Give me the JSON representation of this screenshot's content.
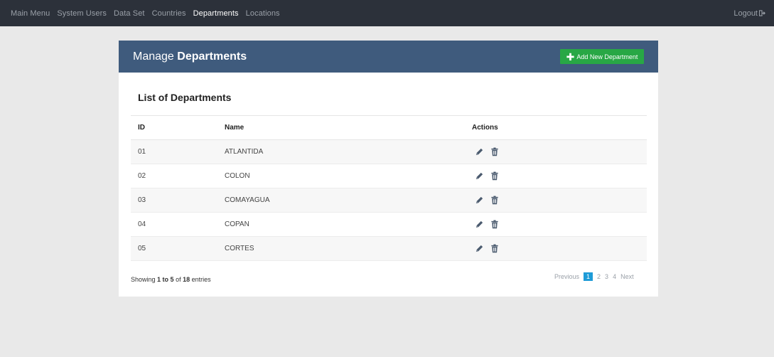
{
  "nav": {
    "items": [
      {
        "label": "Main Menu"
      },
      {
        "label": "System Users"
      },
      {
        "label": "Data Set"
      },
      {
        "label": "Countries"
      },
      {
        "label": "Departments"
      },
      {
        "label": "Locations"
      }
    ],
    "active": "Departments",
    "logout_label": "Logout"
  },
  "panel": {
    "title_prefix": "Manage",
    "title_main": "Departments",
    "add_button_label": "Add New Department",
    "list_title": "List of Departments"
  },
  "table": {
    "headers": [
      "ID",
      "Name",
      "Actions"
    ],
    "rows": [
      {
        "id": "01",
        "name": "ATLANTIDA"
      },
      {
        "id": "02",
        "name": "COLON"
      },
      {
        "id": "03",
        "name": "COMAYAGUA"
      },
      {
        "id": "04",
        "name": "COPAN"
      },
      {
        "id": "05",
        "name": "CORTES"
      }
    ]
  },
  "footer": {
    "showing_prefix": "Showing",
    "range": "1 to 5",
    "of_word": "of",
    "total": "18",
    "suffix": "entries"
  },
  "pagination": {
    "previous": "Previous",
    "pages": [
      "1",
      "2",
      "3",
      "4"
    ],
    "current": "1",
    "next": "Next"
  },
  "colors": {
    "nav_bg": "#2c313a",
    "header_bg": "#3f5b7d",
    "add_button": "#28a745",
    "page_active": "#1e9bd7"
  },
  "icons": [
    "plus-icon",
    "logout-icon",
    "pencil-icon",
    "trash-icon"
  ]
}
